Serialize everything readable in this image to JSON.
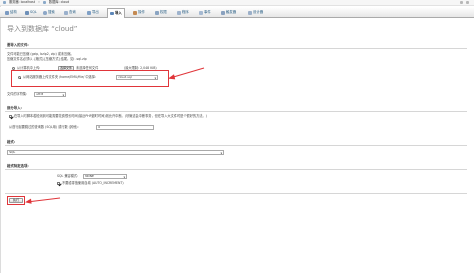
{
  "window": {
    "breadcrumb": [
      "服务器: localhost",
      "数据库: cloud"
    ]
  },
  "tabs": [
    {
      "label": "结构",
      "icon": "structure-icon",
      "active": false
    },
    {
      "label": "SQL",
      "icon": "sql-icon",
      "active": false
    },
    {
      "label": "搜索",
      "icon": "search-icon",
      "active": false
    },
    {
      "label": "查询",
      "icon": "query-icon",
      "active": false
    },
    {
      "label": "导出",
      "icon": "export-icon",
      "active": false
    },
    {
      "label": "导入",
      "icon": "import-icon",
      "active": true
    },
    {
      "label": "操作",
      "icon": "operations-icon",
      "active": false
    },
    {
      "label": "权限",
      "icon": "privileges-icon",
      "active": false
    },
    {
      "label": "程序",
      "icon": "routines-icon",
      "active": false
    },
    {
      "label": "事件",
      "icon": "events-icon",
      "active": false
    },
    {
      "label": "触发器",
      "icon": "triggers-icon",
      "active": false
    },
    {
      "label": "设计器",
      "icon": "designer-icon",
      "active": false
    }
  ],
  "page_title": "导入到数据库 “cloud”",
  "file_section": {
    "title": "要导入的文件:",
    "hint_line1": "文件可能已压缩 (gzip, bzip2, zip) 或未压缩。",
    "hint_line2": "压缩文件名必须以 .[格式].[压缩方式] 结尾。如: .sql.zip",
    "upload_option_label": "从计算机中上传:",
    "choose_file_button": "选择文件",
    "no_file_text": "未选择任何文件",
    "max_size_text": "(最大限制: 2,048 KiB)",
    "server_option_label": "从网站服务器上传文件夹 /home/EMU/file/ 中选择:",
    "server_file_value": "cloud.sql",
    "encoding_label": "文件的字符集:",
    "encoding_value": "utf-8"
  },
  "partial_section": {
    "title": "部分导入:",
    "interrupt_label": "在导入时脚本若检测到可能需要花费很长时间(接近PHP超时时间)则允许中断。(尽管这会中断事务，但在导入大文件时是个很好的方法。)",
    "skip_label": "从首行起要跳过的查询数 (SQL用) 或行数 (其他):",
    "skip_value": "0"
  },
  "format_section": {
    "title": "格式:",
    "format_value": "SQL"
  },
  "options_section": {
    "title": "格式特定选项:",
    "compat_label": "SQL 兼容模式:",
    "compat_value": "NONE",
    "auto_increment_label": "不要给零值使用自增 (AUTO_INCREMENT)"
  },
  "go_button": "执行",
  "annotation_color": "#e0353a",
  "colors": {
    "link": "#235a81",
    "tab_gradient_bottom": "#e6e6e6"
  }
}
